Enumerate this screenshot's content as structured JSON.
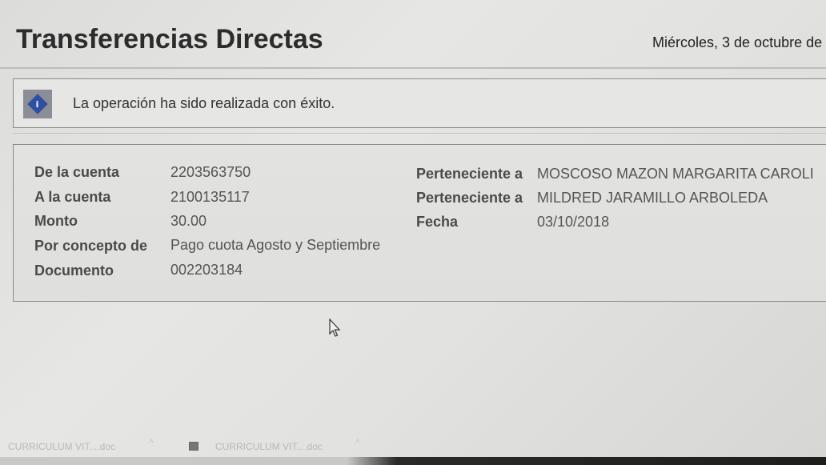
{
  "header": {
    "title": "Transferencias Directas",
    "date": "Miércoles, 3 de octubre de"
  },
  "alert": {
    "icon": "info-icon",
    "message": "La operación ha sido realizada con éxito."
  },
  "details": {
    "from_account_label": "De la cuenta",
    "from_account_value": "2203563750",
    "to_account_label": "A la cuenta",
    "to_account_value": "2100135117",
    "amount_label": "Monto",
    "amount_value": "30.00",
    "concept_label": "Por concepto de",
    "concept_value": "Pago cuota Agosto y Septiembre",
    "document_label": "Documento",
    "document_value": "002203184",
    "from_owner_label": "Perteneciente a",
    "from_owner_value": "MOSCOSO MAZON MARGARITA CAROLI",
    "to_owner_label": "Perteneciente a",
    "to_owner_value": "MILDRED JARAMILLO ARBOLEDA",
    "date_label": "Fecha",
    "date_value": "03/10/2018"
  },
  "taskbar": {
    "downloads": [
      {
        "label": "CURRICULUM VIT....doc"
      },
      {
        "label": "CURRICULUM VIT....doc"
      }
    ]
  }
}
